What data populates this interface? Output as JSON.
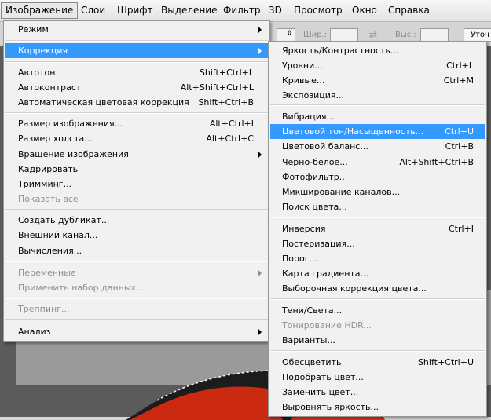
{
  "menubar": {
    "items": [
      "Изображение",
      "Слои",
      "Шрифт",
      "Выделение",
      "Фильтр",
      "3D",
      "Просмотр",
      "Окно",
      "Справка"
    ]
  },
  "optionsbar": {
    "width_label": "Шир.:",
    "height_label": "Выс.:",
    "refine_label": "Уточ"
  },
  "image_menu": {
    "items": [
      {
        "label": "Режим",
        "shortcut": "",
        "submenu": true
      },
      {
        "label": "Коррекция",
        "shortcut": "",
        "submenu": true
      },
      {
        "label": "Автотон",
        "shortcut": "Shift+Ctrl+L"
      },
      {
        "label": "Автоконтраст",
        "shortcut": "Alt+Shift+Ctrl+L"
      },
      {
        "label": "Автоматическая цветовая коррекция",
        "shortcut": "Shift+Ctrl+B"
      },
      {
        "label": "Размер изображения...",
        "shortcut": "Alt+Ctrl+I"
      },
      {
        "label": "Размер холста...",
        "shortcut": "Alt+Ctrl+C"
      },
      {
        "label": "Вращение изображения",
        "shortcut": "",
        "submenu": true
      },
      {
        "label": "Кадрировать",
        "shortcut": ""
      },
      {
        "label": "Тримминг...",
        "shortcut": ""
      },
      {
        "label": "Показать все",
        "shortcut": "",
        "disabled": true
      },
      {
        "label": "Создать дубликат...",
        "shortcut": ""
      },
      {
        "label": "Внешний канал...",
        "shortcut": ""
      },
      {
        "label": "Вычисления...",
        "shortcut": ""
      },
      {
        "label": "Переменные",
        "shortcut": "",
        "submenu": true,
        "disabled": true
      },
      {
        "label": "Применить набор данных...",
        "shortcut": "",
        "disabled": true
      },
      {
        "label": "Треппинг...",
        "shortcut": "",
        "disabled": true
      },
      {
        "label": "Анализ",
        "shortcut": "",
        "submenu": true
      }
    ]
  },
  "adjust_menu": {
    "items": [
      {
        "label": "Яркость/Контрастность...",
        "shortcut": ""
      },
      {
        "label": "Уровни...",
        "shortcut": "Ctrl+L"
      },
      {
        "label": "Кривые...",
        "shortcut": "Ctrl+M"
      },
      {
        "label": "Экспозиция...",
        "shortcut": ""
      },
      {
        "label": "Вибрация...",
        "shortcut": ""
      },
      {
        "label": "Цветовой тон/Насыщенность...",
        "shortcut": "Ctrl+U"
      },
      {
        "label": "Цветовой баланс...",
        "shortcut": "Ctrl+B"
      },
      {
        "label": "Черно-белое...",
        "shortcut": "Alt+Shift+Ctrl+B"
      },
      {
        "label": "Фотофильтр...",
        "shortcut": ""
      },
      {
        "label": "Микширование каналов...",
        "shortcut": ""
      },
      {
        "label": "Поиск цвета...",
        "shortcut": ""
      },
      {
        "label": "Инверсия",
        "shortcut": "Ctrl+I"
      },
      {
        "label": "Постеризация...",
        "shortcut": ""
      },
      {
        "label": "Порог...",
        "shortcut": ""
      },
      {
        "label": "Карта градиента...",
        "shortcut": ""
      },
      {
        "label": "Выборочная коррекция цвета...",
        "shortcut": ""
      },
      {
        "label": "Тени/Света...",
        "shortcut": ""
      },
      {
        "label": "Тонирование HDR...",
        "shortcut": "",
        "disabled": true
      },
      {
        "label": "Варианты...",
        "shortcut": ""
      },
      {
        "label": "Обесцветить",
        "shortcut": "Shift+Ctrl+U"
      },
      {
        "label": "Подобрать цвет...",
        "shortcut": ""
      },
      {
        "label": "Заменить цвет...",
        "shortcut": ""
      },
      {
        "label": "Выровнять яркость...",
        "shortcut": ""
      }
    ]
  },
  "colors": {
    "highlight": "#3399ff",
    "menu_bg": "#f1f1f1",
    "disabled_text": "#8f8f8f"
  }
}
